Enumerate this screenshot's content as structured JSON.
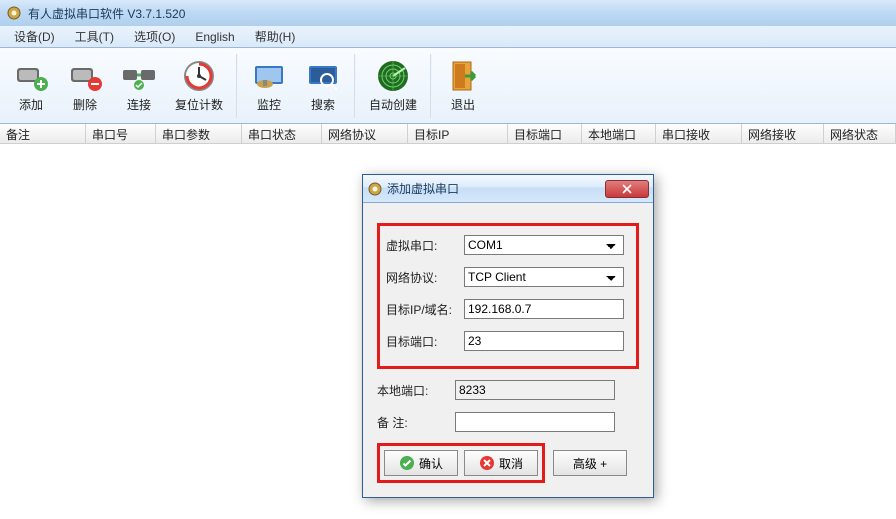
{
  "window": {
    "title": "有人虚拟串口软件 V3.7.1.520"
  },
  "menu": {
    "device": "设备(D)",
    "tools": "工具(T)",
    "options": "选项(O)",
    "english": "English",
    "help": "帮助(H)"
  },
  "toolbar": {
    "add": "添加",
    "delete": "删除",
    "connect": "连接",
    "reset_count": "复位计数",
    "monitor": "监控",
    "search": "搜索",
    "auto_create": "自动创建",
    "exit": "退出"
  },
  "columns": {
    "remark": "备注",
    "com_no": "串口号",
    "com_params": "串口参数",
    "com_state": "串口状态",
    "net_proto": "网络协议",
    "target_ip": "目标IP",
    "target_port": "目标端口",
    "local_port": "本地端口",
    "com_rx": "串口接收",
    "net_rx": "网络接收",
    "net_state": "网络状态"
  },
  "dialog": {
    "title": "添加虚拟串口",
    "labels": {
      "vcom": "虚拟串口:",
      "proto": "网络协议:",
      "target_ip": "目标IP/域名:",
      "target_port": "目标端口:",
      "local_port": "本地端口:",
      "remark": "备 注:"
    },
    "values": {
      "vcom": "COM1",
      "proto": "TCP Client",
      "target_ip": "192.168.0.7",
      "target_port": "23",
      "local_port": "8233",
      "remark": ""
    },
    "buttons": {
      "ok": "确认",
      "cancel": "取消",
      "advanced": "高级 +"
    }
  }
}
